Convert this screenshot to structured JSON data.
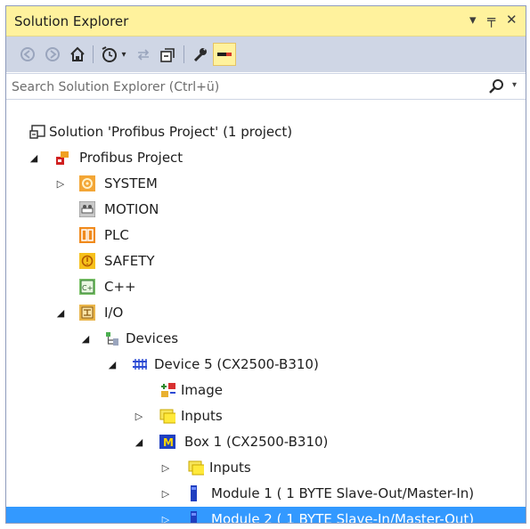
{
  "window": {
    "title": "Solution Explorer",
    "pin_glyph": "▾  ╤  ✕"
  },
  "search": {
    "placeholder": "Search Solution Explorer (Ctrl+ü)"
  },
  "tree": {
    "solution": "Solution 'Profibus Project' (1 project)",
    "project": "Profibus Project",
    "system": "SYSTEM",
    "motion": "MOTION",
    "plc": "PLC",
    "safety": "SAFETY",
    "cpp": "C++",
    "io": "I/O",
    "devices": "Devices",
    "device5": "Device 5 (CX2500-B310)",
    "image": "Image",
    "inputs_device": "Inputs",
    "box1": "Box 1 (CX2500-B310)",
    "inputs_box": "Inputs",
    "module1": "Module 1 ( 1 BYTE Slave-Out/Master-In)",
    "module2": "Module 2 ( 1 BYTE Slave-In/Master-Out)"
  },
  "colors": {
    "selection": "#3399ff",
    "titlebar": "#fff29d",
    "toolbar": "#cfd6e5"
  }
}
